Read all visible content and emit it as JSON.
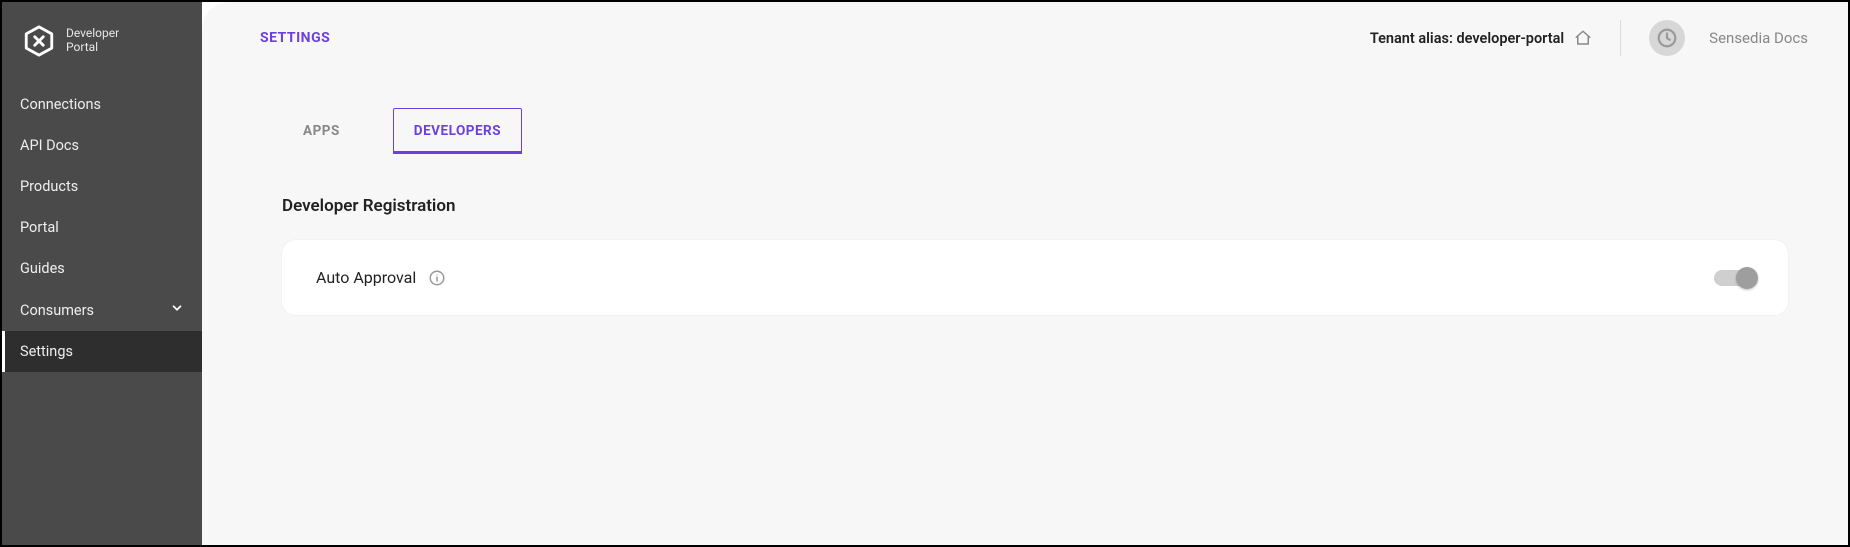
{
  "brand": {
    "line1": "Developer",
    "line2": "Portal"
  },
  "sidebar": {
    "items": [
      {
        "label": "Connections",
        "expandable": false,
        "active": false
      },
      {
        "label": "API Docs",
        "expandable": false,
        "active": false
      },
      {
        "label": "Products",
        "expandable": false,
        "active": false
      },
      {
        "label": "Portal",
        "expandable": false,
        "active": false
      },
      {
        "label": "Guides",
        "expandable": false,
        "active": false
      },
      {
        "label": "Consumers",
        "expandable": true,
        "active": false
      },
      {
        "label": "Settings",
        "expandable": false,
        "active": true
      }
    ]
  },
  "header": {
    "page_title": "SETTINGS",
    "tenant_label": "Tenant alias: developer-portal",
    "user_name": "Sensedia Docs"
  },
  "tabs": [
    {
      "label": "APPS",
      "active": false
    },
    {
      "label": "DEVELOPERS",
      "active": true
    }
  ],
  "section": {
    "title": "Developer Registration",
    "setting_label": "Auto Approval",
    "toggle_on": false
  },
  "colors": {
    "accent": "#6c3fe0"
  }
}
